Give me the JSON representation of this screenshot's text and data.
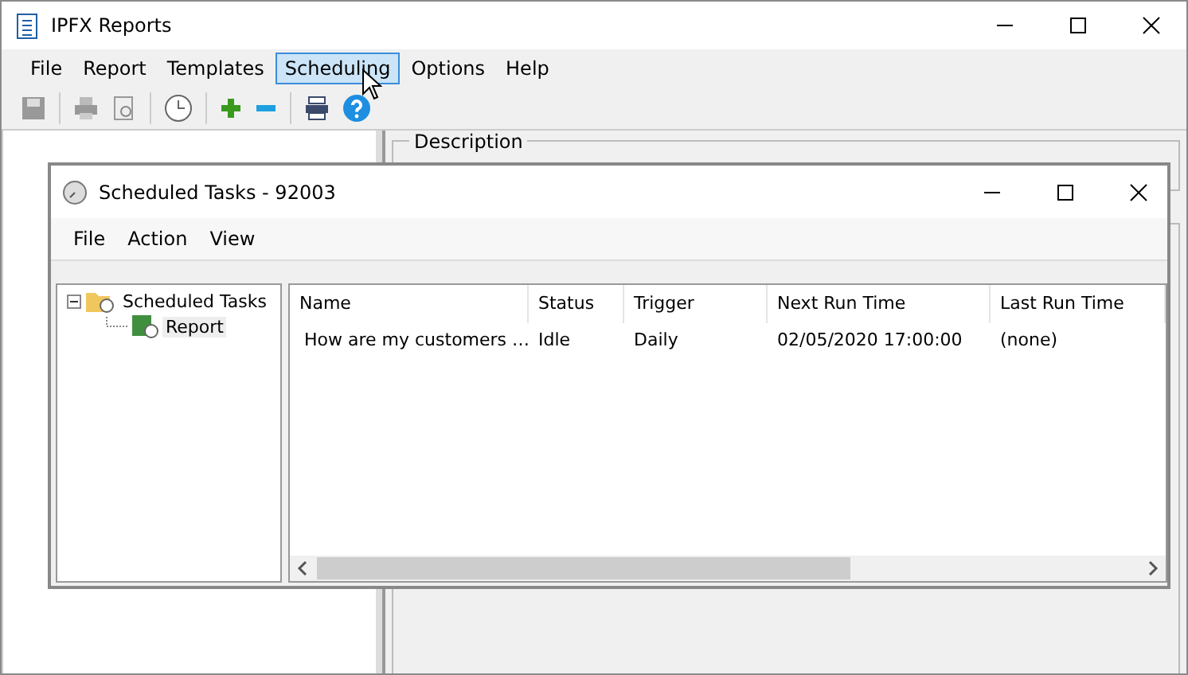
{
  "window": {
    "title": "IPFX Reports"
  },
  "menu": [
    {
      "label": "File",
      "selected": false
    },
    {
      "label": "Report",
      "selected": false
    },
    {
      "label": "Templates",
      "selected": false
    },
    {
      "label": "Scheduling",
      "selected": true
    },
    {
      "label": "Options",
      "selected": false
    },
    {
      "label": "Help",
      "selected": false
    }
  ],
  "description_group": {
    "label": "Description"
  },
  "dialog": {
    "title": "Scheduled Tasks - 92003",
    "menu": [
      "File",
      "Action",
      "View"
    ],
    "tree": [
      {
        "label": "Scheduled Tasks",
        "expanded": true,
        "children": [
          {
            "label": "Report",
            "selected": true
          }
        ]
      }
    ],
    "table": {
      "columns": [
        "Name",
        "Status",
        "Trigger",
        "Next Run Time",
        "Last Run Time"
      ],
      "rows": [
        [
          "How are my customers …",
          "Idle",
          "Daily",
          "02/05/2020 17:00:00",
          "(none)"
        ]
      ]
    }
  }
}
